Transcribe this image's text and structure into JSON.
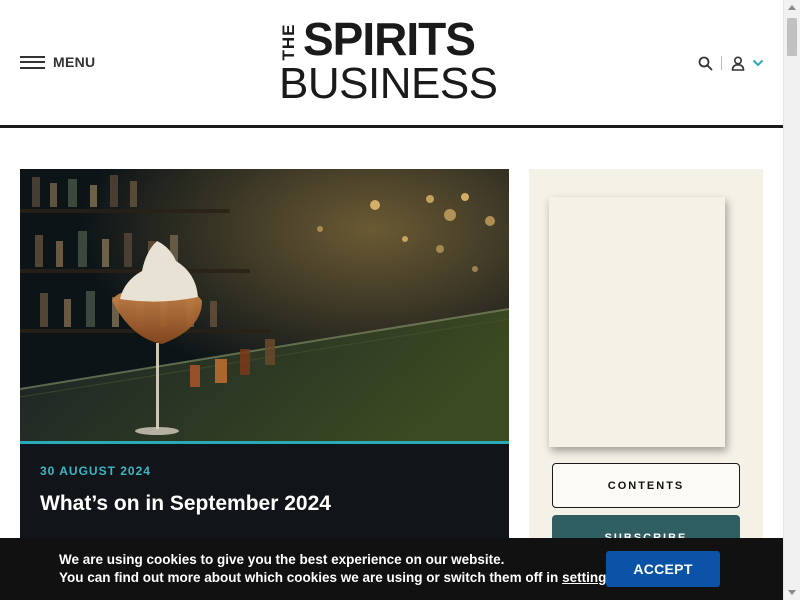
{
  "header": {
    "menu_label": "MENU",
    "logo": {
      "the": "THE",
      "spirits": "SPIRITS",
      "business": "BUSINESS"
    },
    "icons": [
      "search-icon",
      "user-icon",
      "chevron-down-icon"
    ],
    "accent_color": "#2aa9b7"
  },
  "feature": {
    "date": "30 AUGUST 2024",
    "title": "What’s on in September 2024",
    "accent_color": "#3ab7c5"
  },
  "sidebar": {
    "contents_label": "CONTENTS",
    "subscribe_label": "SUBSCRIBE",
    "background": "#f4f1e6"
  },
  "cookie_banner": {
    "line1": "We are using cookies to give you the best experience on our website.",
    "line2_prefix": "You can find out more about which cookies we are using or switch them off in ",
    "settings_link": "settings",
    "line2_suffix": ".",
    "accept_label": "ACCEPT",
    "button_color": "#0a53a6"
  }
}
